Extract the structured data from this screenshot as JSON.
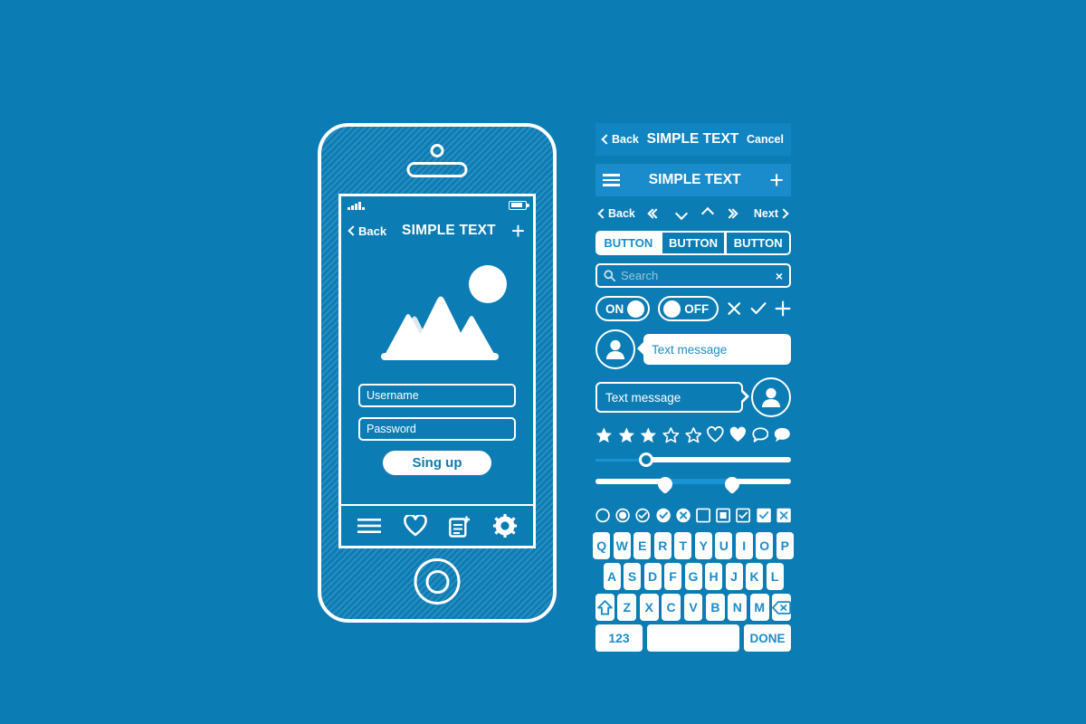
{
  "colors": {
    "background": "#0b7cb4",
    "white": "#ffffff",
    "bar_light": "#1185c2",
    "bar_lighter": "#1b8ccb",
    "placeholder": "#9fc4dc",
    "slider_track_off": "#1a93d4"
  },
  "phone": {
    "statusbar": {
      "signal_icon": "signal-bars-icon",
      "battery_icon": "battery-icon"
    },
    "navbar": {
      "back_label": "Back",
      "title": "SIMPLE TEXT",
      "add_label": "+"
    },
    "hero": {
      "icon": "mountains-photo-icon"
    },
    "form": {
      "username_placeholder": "Username",
      "password_placeholder": "Password",
      "submit_label": "Sing up"
    },
    "tabbar": {
      "items": [
        {
          "name": "menu-icon",
          "label": "Menu"
        },
        {
          "name": "heart-icon",
          "label": "Favorites"
        },
        {
          "name": "new-document-icon",
          "label": "New"
        },
        {
          "name": "gear-icon",
          "label": "Settings"
        }
      ]
    }
  },
  "kit": {
    "topbar1": {
      "back_label": "Back",
      "title": "SIMPLE TEXT",
      "cancel_label": "Cancel"
    },
    "topbar2": {
      "menu_icon": "hamburger-icon",
      "title": "SIMPLE TEXT",
      "add_label": "+"
    },
    "pager": {
      "back_label": "Back",
      "next_label": "Next"
    },
    "buttons": {
      "items": [
        "BUTTON",
        "BUTTON",
        "BUTTON"
      ],
      "selected_index": 0
    },
    "search": {
      "placeholder": "Search",
      "clear_label": "×"
    },
    "toggles": {
      "on_label": "ON",
      "off_label": "OFF",
      "icons": [
        "close-x-icon",
        "check-icon",
        "plus-icon"
      ]
    },
    "chat": {
      "incoming_text": "Text message",
      "outgoing_text": "Text message"
    },
    "rating": {
      "stars_total": 5,
      "stars_filled": 3,
      "icons": [
        "heart-outline-icon",
        "heart-filled-icon",
        "speech-outline-icon",
        "speech-filled-icon"
      ]
    },
    "sliders": {
      "single_value_pct": 25,
      "range_low_pct": 36,
      "range_high_pct": 70
    },
    "checks": {
      "items": [
        "radio-empty-icon",
        "radio-selected-icon",
        "circle-check-outline-icon",
        "circle-check-filled-icon",
        "circle-x-filled-icon",
        "checkbox-empty-icon",
        "checkbox-square-filled-icon",
        "checkbox-check-outline-icon",
        "checkbox-check-filled-icon",
        "checkbox-x-filled-icon"
      ]
    },
    "keyboard": {
      "row1": [
        "Q",
        "W",
        "E",
        "R",
        "T",
        "Y",
        "U",
        "I",
        "O",
        "P"
      ],
      "row2": [
        "A",
        "S",
        "D",
        "F",
        "G",
        "H",
        "J",
        "K",
        "L"
      ],
      "row3_shift": "shift-icon",
      "row3": [
        "Z",
        "X",
        "C",
        "V",
        "B",
        "N",
        "M"
      ],
      "row3_backspace": "backspace-icon",
      "numbers_label": "123",
      "space_label": "",
      "done_label": "DONE"
    }
  }
}
